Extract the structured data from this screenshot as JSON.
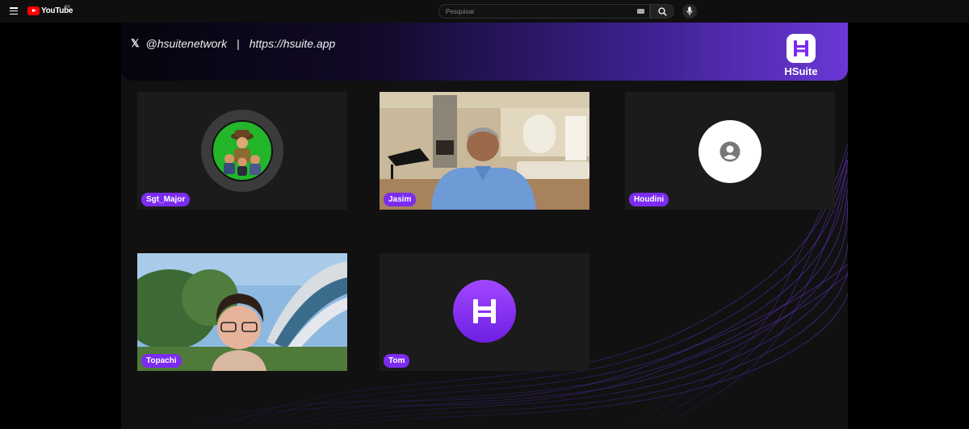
{
  "youtube": {
    "logo_text": "YouTube",
    "region": "BR",
    "search_placeholder": "Pesquisar"
  },
  "banner": {
    "handle": "@hsuitenetwork",
    "separator": "|",
    "url": "https://hsuite.app",
    "brand": "HSuite"
  },
  "participants": [
    {
      "name": "Sgt_Major"
    },
    {
      "name": "Jasim"
    },
    {
      "name": "Houdini"
    },
    {
      "name": "Topachi"
    },
    {
      "name": "Tom"
    }
  ],
  "colors": {
    "badge": "#7b2cf0",
    "brand_purple": "#6a38d6",
    "youtube_red": "#ff0000"
  }
}
